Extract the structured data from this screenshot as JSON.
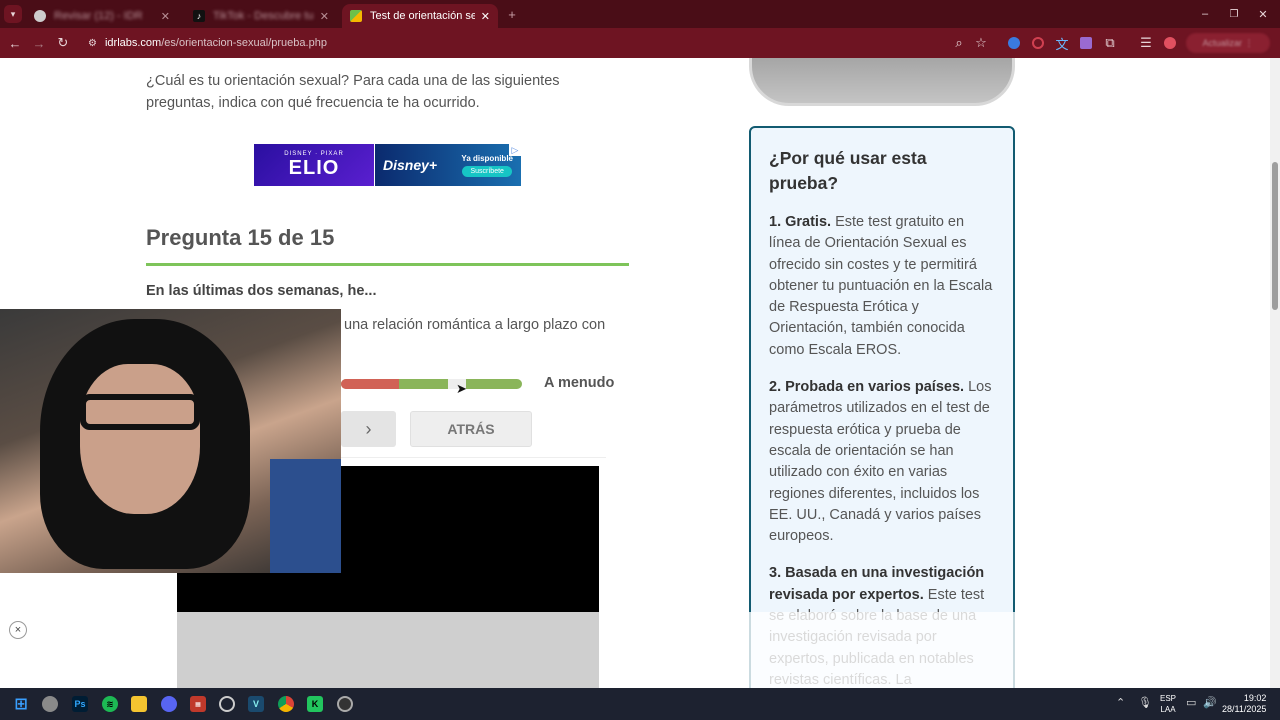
{
  "browser": {
    "tabs": [
      {
        "title": "Revisar (12) - IDR",
        "active": false,
        "favicon": "globe-icon"
      },
      {
        "title": "TikTok - Descubre tus",
        "active": false,
        "favicon": "tiktok-icon"
      },
      {
        "title": "Test de orientación sexual",
        "active": true,
        "favicon": "idrlabs-icon"
      }
    ],
    "url_host": "idrlabs.com",
    "url_path": "/es/orientacion-sexual/prueba.php",
    "profile_label": "Actualizar ⋮"
  },
  "main": {
    "intro": "¿Cuál es tu orientación sexual? Para cada una de las siguientes preguntas, indica con qué frecuencia te ha ocurrido.",
    "ad": {
      "small": "DISNEY · PIXAR",
      "title": "ELIO",
      "brand": "Disney+",
      "cta_top": "Ya disponible",
      "cta_btn": "Suscríbete"
    },
    "question_title": "Pregunta 15 de 15",
    "question_lead": "En las últimas dos semanas, he...",
    "question_text": "una relación romántica a largo plazo con",
    "slider_value_label": "A menudo",
    "slider_level": 0.64,
    "next_glyph": "›",
    "back_label": "ATRÁS"
  },
  "sidebar": {
    "heading": "¿Por qué usar esta prueba?",
    "items": [
      {
        "bold": "1. Gratis.",
        "text": " Este test gratuito en línea de Orientación Sexual es ofrecido sin costes y te permitirá obtener tu puntuación en la Escala de Respuesta Erótica y Orientación, también conocida como Escala EROS."
      },
      {
        "bold": "2. Probada en varios países.",
        "text": " Los parámetros utilizados en el test de respuesta erótica y prueba de escala de orientación se han utilizado con éxito en varias regiones diferentes, incluidos los EE. UU., Canadá y varios países europeos."
      },
      {
        "bold": "3. Basada en una investigación revisada por expertos.",
        "text": " Este test se elaboró sobre la base de una investigación revisada por expertos, publicada en notables revistas científicas. La"
      }
    ]
  },
  "overlay": {
    "close_glyph": "×"
  },
  "taskbar": {
    "lang_top": "ESP",
    "lang_bottom": "LAA",
    "time": "19:02",
    "date": "28/11/2025"
  }
}
